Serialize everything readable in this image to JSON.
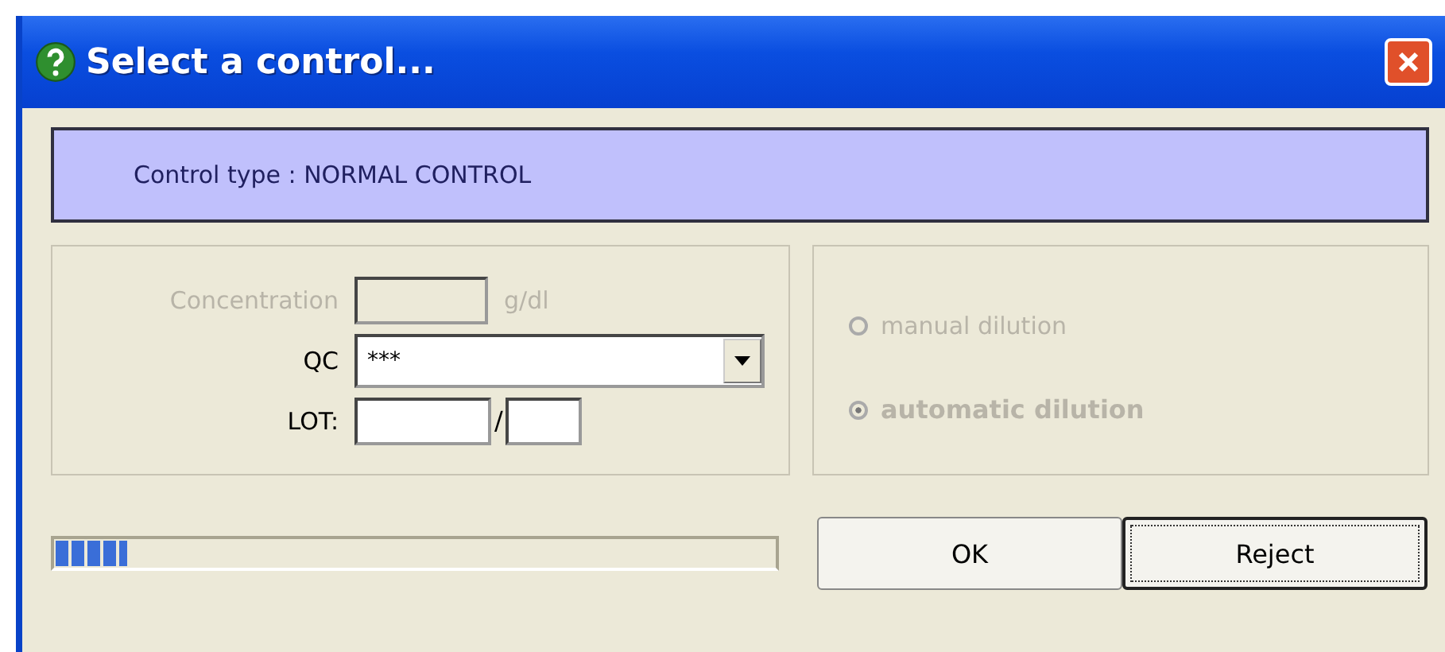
{
  "window": {
    "title": "Select a control..."
  },
  "banner": "Control type : NORMAL CONTROL",
  "concentration": {
    "label": "Concentration",
    "unit": "g/dl",
    "disabled": true
  },
  "qc": {
    "label": "QC",
    "value": "***"
  },
  "lot": {
    "label": "LOT:",
    "separator": "/"
  },
  "dilution": [
    {
      "label": "manual dilution",
      "selected": false,
      "disabled": true
    },
    {
      "label": "automatic dilution",
      "selected": true,
      "disabled": true
    }
  ],
  "progress": {
    "level": 0.1
  },
  "buttons": [
    {
      "label": "OK",
      "default": false
    },
    {
      "label": "Reject",
      "default": true
    }
  ]
}
